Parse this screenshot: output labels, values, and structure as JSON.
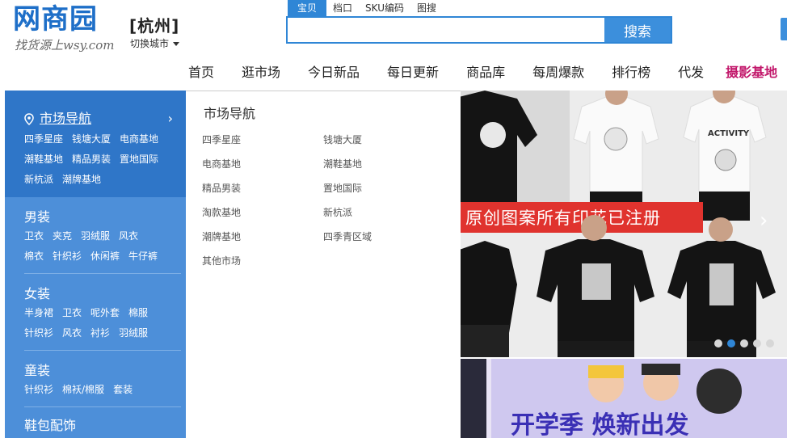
{
  "header": {
    "logo_text": "网商园",
    "logo_sub": "找货源上wsy.com",
    "city": "[杭州]",
    "city_switch": "切换城市"
  },
  "search": {
    "tabs": [
      "宝贝",
      "档口",
      "SKU编码",
      "图搜"
    ],
    "active_tab": 0,
    "placeholder": "",
    "button_label": "搜索"
  },
  "nav": {
    "items": [
      "首页",
      "逛市场",
      "今日新品",
      "每日更新",
      "商品库",
      "每周爆款",
      "排行榜",
      "代发"
    ],
    "special": "摄影基地"
  },
  "sidebar": {
    "market": {
      "title": "市场导航",
      "links": [
        "四季星座",
        "钱塘大厦",
        "电商基地",
        "潮鞋基地",
        "精品男装",
        "置地国际",
        "新杭派",
        "潮牌基地"
      ]
    },
    "sections": [
      {
        "title": "男装",
        "links": [
          "卫衣",
          "夹克",
          "羽绒服",
          "风衣",
          "棉衣",
          "针织衫",
          "休闲裤",
          "牛仔裤"
        ]
      },
      {
        "title": "女装",
        "links": [
          "半身裙",
          "卫衣",
          "呢外套",
          "棉服",
          "针织衫",
          "风衣",
          "衬衫",
          "羽绒服"
        ]
      },
      {
        "title": "童装",
        "links": [
          "针织衫",
          "棉袄/棉服",
          "套装"
        ]
      },
      {
        "title": "鞋包配饰",
        "links": []
      }
    ]
  },
  "dropdown": {
    "title": "市场导航",
    "items": [
      "四季星座",
      "钱塘大厦",
      "电商基地",
      "潮鞋基地",
      "精品男装",
      "置地国际",
      "淘款基地",
      "新杭派",
      "潮牌基地",
      "四季青区域",
      "其他市场"
    ]
  },
  "banner": {
    "caption": "原创图案所有印花已注册",
    "tshirt_text": "ACTIVITY",
    "dots": 5,
    "active_dot": 1,
    "second_caption": "开学季 焕新出发",
    "colors": {
      "accent": "#2f86d6",
      "caption_bg": "#e0332e"
    }
  }
}
